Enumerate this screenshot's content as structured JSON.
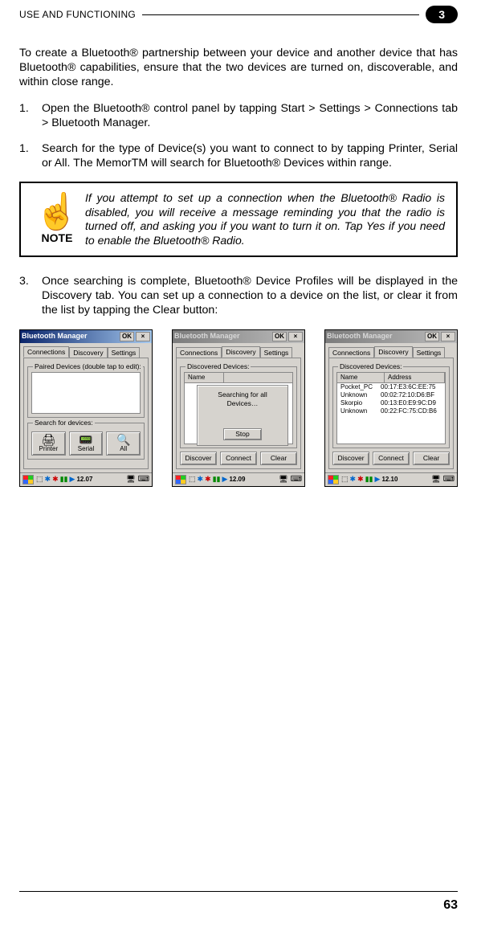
{
  "header": {
    "title": "USE AND FUNCTIONING",
    "badge": "3"
  },
  "paragraphs": {
    "intro": "To create a Bluetooth® partnership between your device and another device that has Bluetooth® capabilities, ensure that the two devices are turned on, discoverable, and within close range.",
    "step1_num": "1.",
    "step1": "Open the Bluetooth® control panel by tapping Start > Settings > Connections tab > Bluetooth Manager.",
    "step2_num": "1.",
    "step2": "Search for the type of Device(s) you want to connect to by tapping Printer, Serial or All. The MemorTM will search for Bluetooth® Devices within range.",
    "step3_num": "3.",
    "step3": "Once searching is complete, Bluetooth® Device Profiles will be displayed in the Discovery tab. You can set up a connection to a device on the list, or clear it from the list by tapping the Clear button:"
  },
  "note": {
    "label": "NOTE",
    "text": "If you attempt to set up a connection when the Bluetooth® Radio is disabled, you will receive a message reminding you that the radio is turned off, and asking you if you want to turn it on. Tap Yes if you need to enable the Bluetooth® Radio."
  },
  "screens": {
    "s1": {
      "title": "Bluetooth Manager",
      "ok": "OK",
      "close": "×",
      "tab1": "Connections",
      "tab2": "Discovery",
      "tab3": "Settings",
      "grp1": "Paired Devices (double tap to edit):",
      "grp2": "Search for devices:",
      "btn_printer": "Printer",
      "btn_serial": "Serial",
      "btn_all": "All",
      "time": "12.07"
    },
    "s2": {
      "title": "Bluetooth Manager",
      "ok": "OK",
      "close": "×",
      "tab1": "Connections",
      "tab2": "Discovery",
      "tab3": "Settings",
      "grp": "Discovered Devices:",
      "col1": "Name",
      "dialog_text": "Searching for all Devices…",
      "dialog_stop": "Stop",
      "btn_discover": "Discover",
      "btn_connect": "Connect",
      "btn_clear": "Clear",
      "time": "12.09"
    },
    "s3": {
      "title": "Bluetooth Manager",
      "ok": "OK",
      "close": "×",
      "tab1": "Connections",
      "tab2": "Discovery",
      "tab3": "Settings",
      "grp": "Discovered Devices:",
      "col1": "Name",
      "col2": "Address",
      "rows": [
        {
          "name": "Pocket_PC",
          "addr": "00:17:E3:6C:EE:75"
        },
        {
          "name": "Unknown",
          "addr": "00:02:72:10:D6:BF"
        },
        {
          "name": "Skorpio",
          "addr": "00:13:E0:E9:9C:D9"
        },
        {
          "name": "Unknown",
          "addr": "00:22:FC:75:CD:B6"
        }
      ],
      "btn_discover": "Discover",
      "btn_connect": "Connect",
      "btn_clear": "Clear",
      "time": "12.10"
    }
  },
  "page_number": "63"
}
